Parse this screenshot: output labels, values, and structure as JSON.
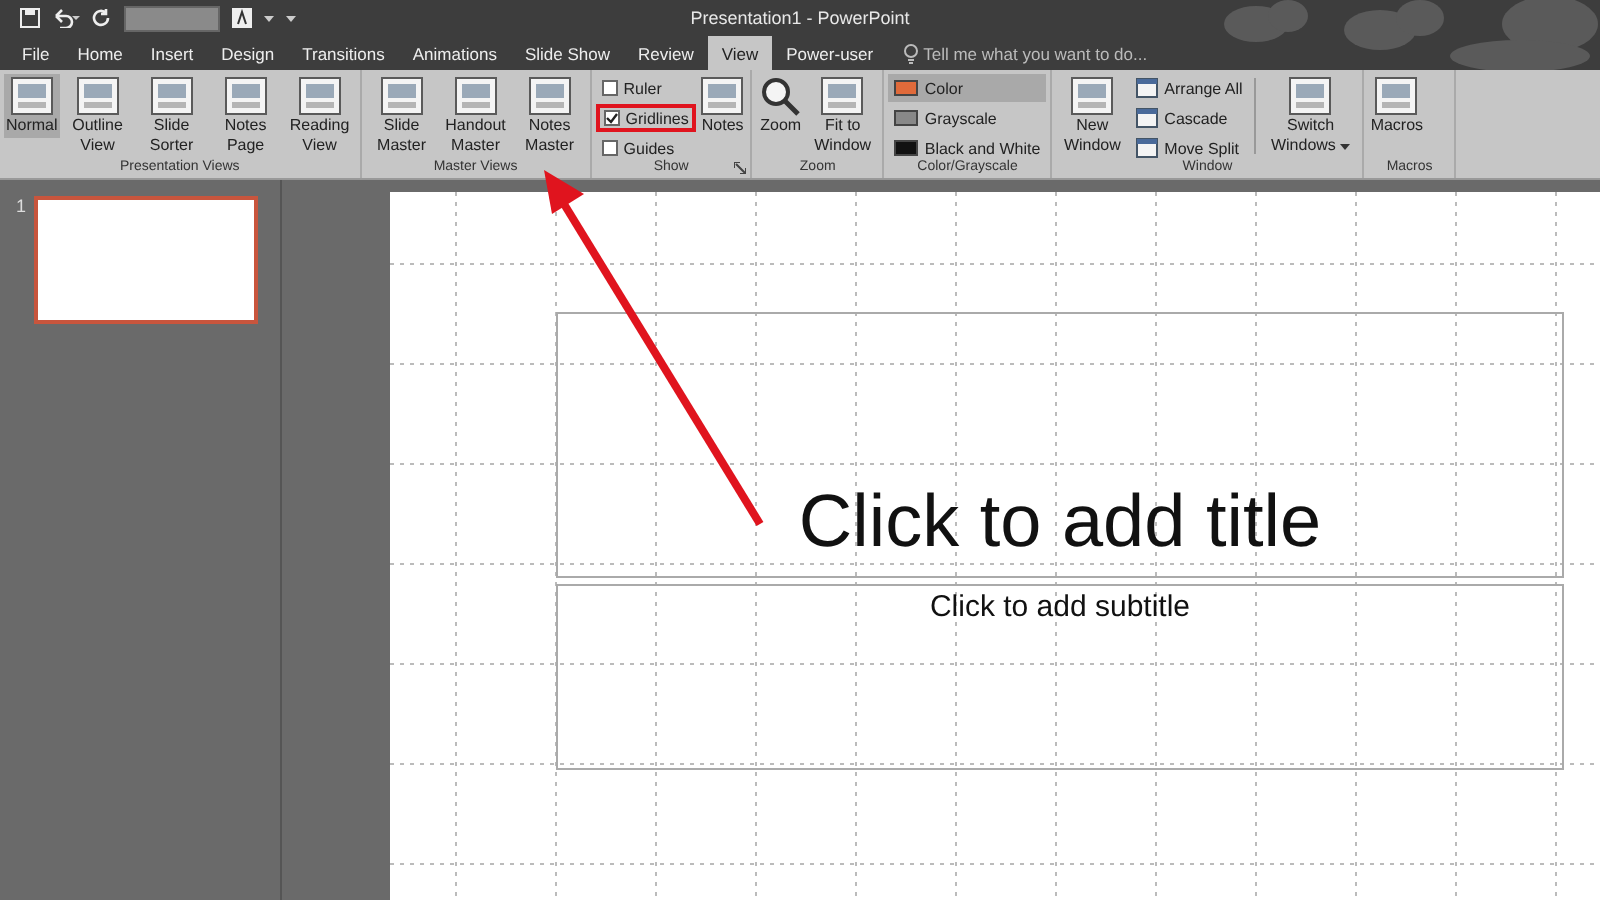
{
  "window": {
    "title": "Presentation1 - PowerPoint"
  },
  "tabs": [
    {
      "label": "File",
      "selected": false
    },
    {
      "label": "Home",
      "selected": false
    },
    {
      "label": "Insert",
      "selected": false
    },
    {
      "label": "Design",
      "selected": false
    },
    {
      "label": "Transitions",
      "selected": false
    },
    {
      "label": "Animations",
      "selected": false
    },
    {
      "label": "Slide Show",
      "selected": false
    },
    {
      "label": "Review",
      "selected": false
    },
    {
      "label": "View",
      "selected": true
    },
    {
      "label": "Power-user",
      "selected": false
    }
  ],
  "search": {
    "placeholder": "Tell me what you want to do..."
  },
  "ribbon": {
    "groups": [
      {
        "label": "Presentation Views",
        "items": [
          {
            "kind": "large",
            "label": "Normal",
            "selected": true
          },
          {
            "kind": "large",
            "label": "Outline View",
            "selected": false
          },
          {
            "kind": "large",
            "label": "Slide Sorter",
            "selected": false
          },
          {
            "kind": "large",
            "label": "Notes Page",
            "selected": false
          },
          {
            "kind": "large",
            "label": "Reading View",
            "selected": false
          }
        ]
      },
      {
        "label": "Master Views",
        "items": [
          {
            "kind": "large",
            "label": "Slide Master",
            "selected": false
          },
          {
            "kind": "large",
            "label": "Handout Master",
            "selected": false
          },
          {
            "kind": "large",
            "label": "Notes Master",
            "selected": false
          }
        ]
      },
      {
        "label": "Show",
        "launcher": true,
        "items": [
          {
            "kind": "check",
            "label": "Ruler",
            "checked": false,
            "highlighted": false
          },
          {
            "kind": "check",
            "label": "Gridlines",
            "checked": true,
            "highlighted": true
          },
          {
            "kind": "check",
            "label": "Guides",
            "checked": false,
            "highlighted": false
          },
          {
            "kind": "large",
            "label": "Notes",
            "selected": false
          }
        ]
      },
      {
        "label": "Zoom",
        "items": [
          {
            "kind": "zoom",
            "label": "Zoom",
            "selected": false
          },
          {
            "kind": "large",
            "label": "Fit to Window",
            "selected": false
          }
        ]
      },
      {
        "label": "Color/Grayscale",
        "items": [
          {
            "kind": "swatch",
            "label": "Color",
            "selected": true
          },
          {
            "kind": "swatch",
            "label": "Grayscale",
            "selected": false
          },
          {
            "kind": "swatch",
            "label": "Black and White",
            "selected": false
          }
        ]
      },
      {
        "label": "Window",
        "items": [
          {
            "kind": "large",
            "label": "New Window",
            "selected": false
          },
          {
            "kind": "small",
            "label": "Arrange All"
          },
          {
            "kind": "small",
            "label": "Cascade"
          },
          {
            "kind": "small",
            "label": "Move Split"
          },
          {
            "kind": "separator"
          },
          {
            "kind": "large",
            "label": "Switch Windows",
            "selected": false,
            "dropdown": true
          }
        ]
      },
      {
        "label": "Macros",
        "items": [
          {
            "kind": "large",
            "label": "Macros",
            "selected": false
          }
        ]
      }
    ]
  },
  "slides": [
    {
      "number": "1",
      "selected": true
    }
  ],
  "slide": {
    "title_placeholder": "Click to add title",
    "subtitle_placeholder": "Click to add subtitle"
  }
}
